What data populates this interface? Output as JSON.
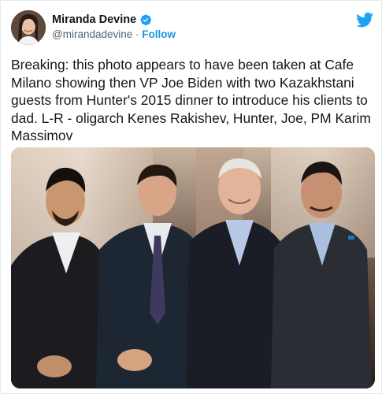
{
  "tweet": {
    "author": {
      "display_name": "Miranda Devine",
      "handle": "@mirandadevine",
      "separator": " · ",
      "follow_label": "Follow"
    },
    "text": "Breaking: this photo appears to have been taken at Cafe Milano showing then VP Joe Biden with two Kazakhstani guests from Hunter's 2015 dinner to introduce his clients to dad. L-R - oligarch Kenes Rakishev, Hunter, Joe, PM Karim Massimov"
  },
  "colors": {
    "accent": "#1b95e0",
    "twitter_blue": "#1da1f2",
    "text": "#14171a",
    "muted": "#536471"
  },
  "icons": {
    "verified": "verified-badge-icon",
    "brand": "twitter-bird-icon"
  }
}
